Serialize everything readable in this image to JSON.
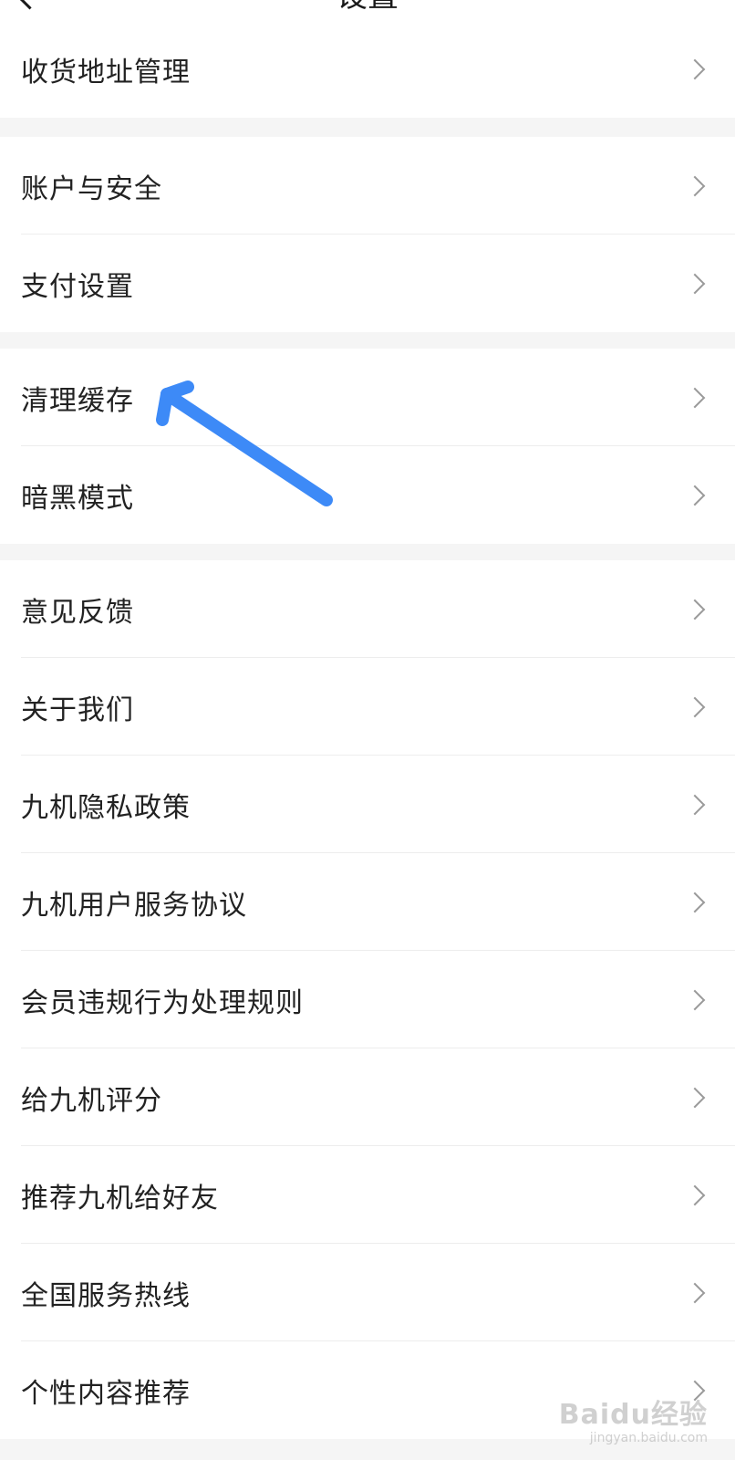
{
  "header": {
    "title": "设置"
  },
  "groups": [
    {
      "items": [
        {
          "label": "收货地址管理"
        }
      ]
    },
    {
      "items": [
        {
          "label": "账户与安全"
        },
        {
          "label": "支付设置"
        }
      ]
    },
    {
      "items": [
        {
          "label": "清理缓存"
        },
        {
          "label": "暗黑模式"
        }
      ]
    },
    {
      "items": [
        {
          "label": "意见反馈"
        },
        {
          "label": "关于我们"
        },
        {
          "label": "九机隐私政策"
        },
        {
          "label": "九机用户服务协议"
        },
        {
          "label": "会员违规行为处理规则"
        },
        {
          "label": "给九机评分"
        },
        {
          "label": "推荐九机给好友"
        },
        {
          "label": "全国服务热线"
        },
        {
          "label": "个性内容推荐"
        }
      ]
    }
  ],
  "annotation": {
    "arrow_color": "#3d8af7",
    "target": "清理缓存"
  },
  "watermark": {
    "main": "Baidu经验",
    "sub": "jingyan.baidu.com"
  },
  "colors": {
    "background": "#f5f5f5",
    "card": "#ffffff",
    "text": "#222222",
    "chevron": "#9a9a9a"
  }
}
